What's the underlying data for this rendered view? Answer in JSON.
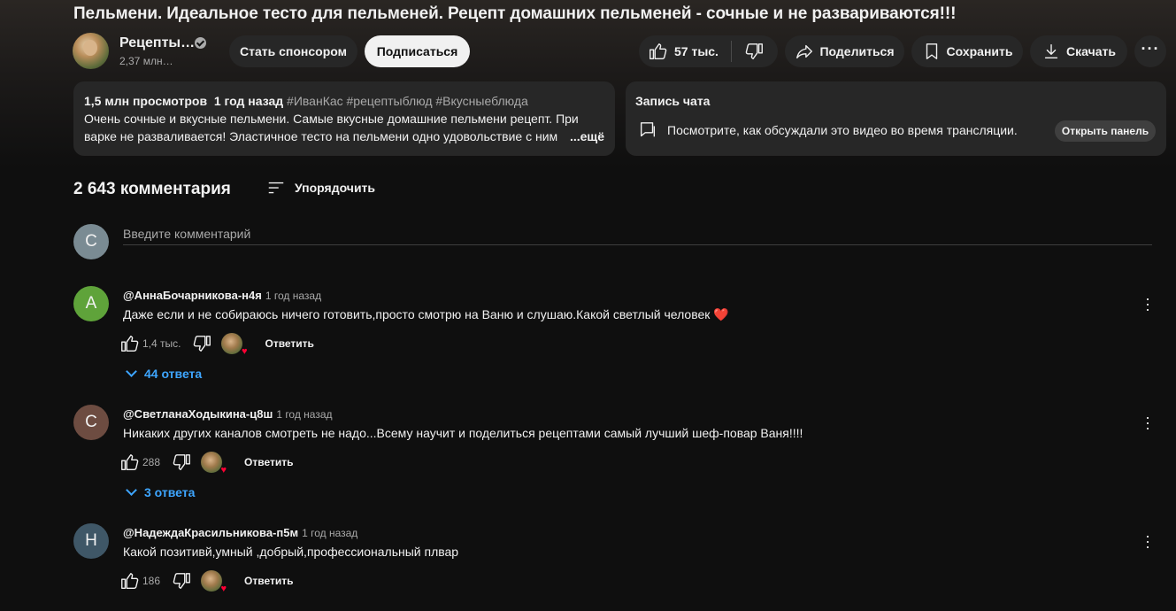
{
  "video": {
    "title": "Пельмени. Идеальное тесто для пельменей. Рецепт домашних пельменей - сочные и не развариваются!!!"
  },
  "channel": {
    "name": "Рецепты…",
    "subscribers": "2,37 млн…"
  },
  "buttons": {
    "sponsor": "Стать спонсором",
    "subscribe": "Подписаться",
    "likes": "57 тыс.",
    "share": "Поделиться",
    "save": "Сохранить",
    "download": "Скачать"
  },
  "description": {
    "meta": "1,5 млн просмотров  1 год назад",
    "tags": "#ИванКас #рецептыблюд #Вкусныеблюда",
    "text": "Очень сочные и вкусные пельмени. Самые вкусные домашние пельмени рецепт. При варке не разваливается! Эластичное тесто на пельмени одно удовольствие с ним",
    "more": "...ещё"
  },
  "chat": {
    "title": "Запись чата",
    "text": "Посмотрите, как обсуждали это видео во время трансляции.",
    "open_button": "Открыть панель"
  },
  "comments_header": {
    "count": "2 643 комментария",
    "sort_label": "Упорядочить"
  },
  "comment_input": {
    "avatar_letter": "С",
    "placeholder": "Введите комментарий"
  },
  "comments": [
    {
      "avatar_letter": "А",
      "avatar_color": "#5fa33a",
      "author": "@АннаБочарникова-н4я",
      "time": "1 год назад",
      "text": "Даже если и не собираюсь ничего готовить,просто смотрю на Ваню и слушаю.Какой светлый человек",
      "emoji": "❤️",
      "likes": "1,4 тыс.",
      "reply_label": "Ответить",
      "replies_label": "44 ответа"
    },
    {
      "avatar_letter": "С",
      "avatar_color": "#6d4c41",
      "author": "@СветланаХодыкина-ц8ш",
      "time": "1 год назад",
      "text": "Никаких других каналов смотреть не надо...Всему научит и поделиться рецептами самый лучший шеф-повар Ваня!!!!",
      "likes": "288",
      "reply_label": "Ответить",
      "replies_label": "3 ответа"
    },
    {
      "avatar_letter": "Н",
      "avatar_color": "#3f5767",
      "author": "@НадеждаКрасильникова-п5м",
      "time": "1 год назад",
      "text": "Какой позитивй,умный ,добрый,профессиональный плвар",
      "likes": "186",
      "reply_label": "Ответить"
    }
  ]
}
